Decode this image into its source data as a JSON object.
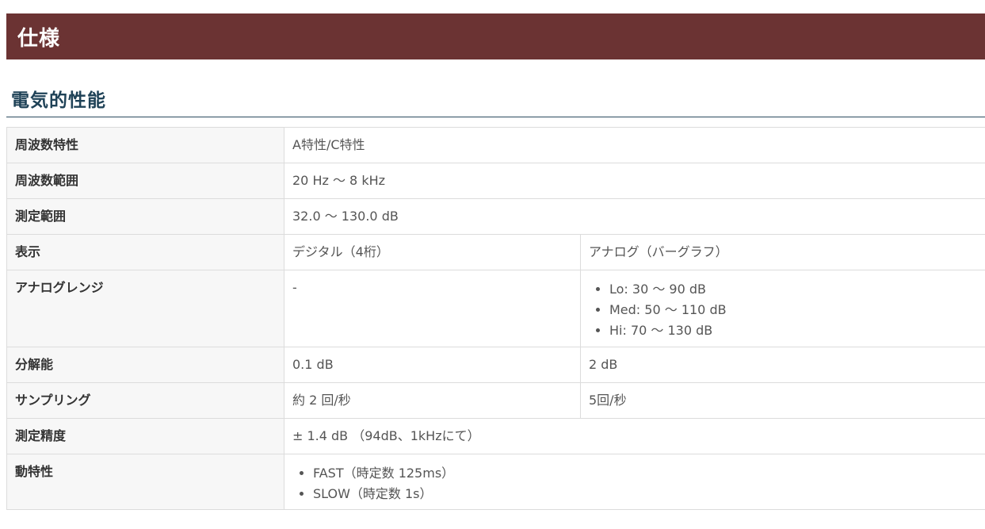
{
  "header": {
    "title": "仕様"
  },
  "section": {
    "title": "電気的性能"
  },
  "rows": [
    {
      "label": "周波数特性",
      "value": "A特性/C特性"
    },
    {
      "label": "周波数範囲",
      "value": "20 Hz 〜 8 kHz"
    },
    {
      "label": "測定範囲",
      "value": "32.0 〜 130.0 dB"
    },
    {
      "label": "表示",
      "digital": "デジタル（4桁）",
      "analog": "アナログ（バーグラフ）"
    },
    {
      "label": "アナログレンジ",
      "digital": "-",
      "analog_list": [
        "Lo: 30 〜 90 dB",
        "Med: 50 〜 110 dB",
        "Hi: 70 〜 130 dB"
      ]
    },
    {
      "label": "分解能",
      "digital": "0.1 dB",
      "analog": "2 dB"
    },
    {
      "label": "サンプリング",
      "digital": "約 2 回/秒",
      "analog": "5回/秒"
    },
    {
      "label": "測定精度",
      "value": "± 1.4 dB （94dB、1kHzにて）"
    },
    {
      "label": "動特性",
      "value_list": [
        "FAST（時定数 125ms）",
        "SLOW（時定数 1s）"
      ]
    }
  ]
}
